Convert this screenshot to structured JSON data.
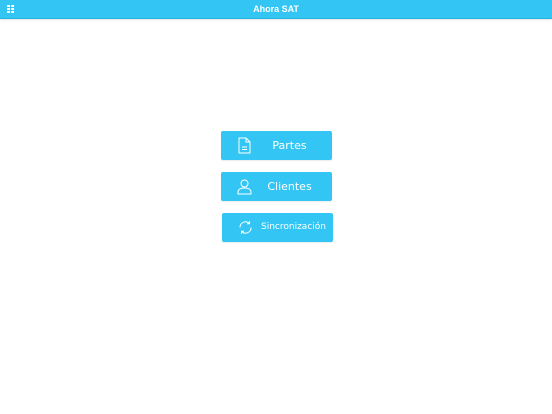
{
  "header": {
    "title": "Ahora SAT",
    "menu_icon": "grid-menu-icon"
  },
  "colors": {
    "accent": "#33c6f5",
    "background": "#ffffff",
    "text_on_accent": "#ffffff"
  },
  "main_menu": {
    "items": [
      {
        "label": "Partes",
        "icon": "document-icon"
      },
      {
        "label": "Clientes",
        "icon": "user-icon"
      },
      {
        "label": "Sincronización",
        "icon": "sync-icon"
      }
    ]
  }
}
